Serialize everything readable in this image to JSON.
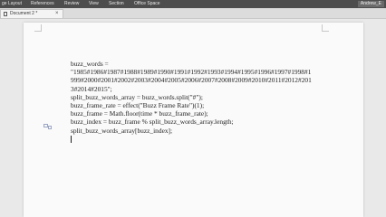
{
  "menu": {
    "items": [
      "ge Layout",
      "References",
      "Review",
      "View",
      "Section",
      "Office Space"
    ],
    "user": "Andrew_E"
  },
  "tab": {
    "title": "Document 2 *",
    "close": "×"
  },
  "document": {
    "lines": [
      "buzz_words =",
      "\"1985#1986#1987#1988#1989#1990#1991#1992#1993#1994#1995#1996#1997#1998#1",
      "999#2000#2001#2002#2003#2004#2005#2006#2007#2008#2009#2010#2011#2012#201",
      "3#2014#2015\";",
      "split_buzz_words_array = buzz_words.split(\"#\");",
      "buzz_frame_rate = effect(\"Buzz Frame Rate\")(1);",
      "buzz_frame = Math.floor(time * buzz_frame_rate);",
      "buzz_index = buzz_frame % split_buzz_words_array.length;",
      "split_buzz_words_array[buzz_index];"
    ]
  }
}
